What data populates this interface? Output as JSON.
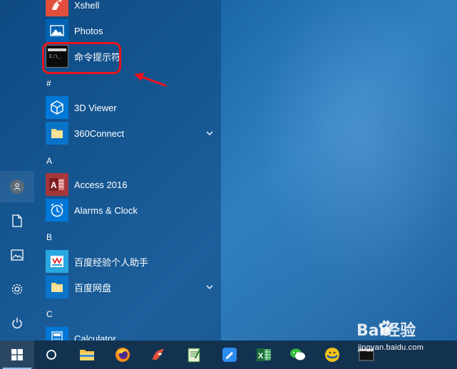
{
  "start_menu": {
    "sections": [
      {
        "letter": ""
      },
      {
        "letter": "#"
      },
      {
        "letter": "A"
      },
      {
        "letter": "B"
      },
      {
        "letter": "C"
      }
    ],
    "apps": {
      "xshell": {
        "label": "Xshell",
        "icon": "xshell-icon"
      },
      "photos": {
        "label": "Photos",
        "icon": "photos-icon"
      },
      "cmd": {
        "label": "命令提示符",
        "icon": "command-prompt-icon"
      },
      "viewer3d": {
        "label": "3D Viewer",
        "icon": "3d-viewer-icon"
      },
      "connect360": {
        "label": "360Connect",
        "icon": "folder-icon"
      },
      "access": {
        "label": "Access 2016",
        "icon": "access-icon"
      },
      "alarms": {
        "label": "Alarms & Clock",
        "icon": "alarm-clock-icon"
      },
      "baidu_helper": {
        "label": "百度经验个人助手",
        "icon": "baidu-helper-icon"
      },
      "baidu_pan": {
        "label": "百度网盘",
        "icon": "folder-icon"
      },
      "calculator": {
        "label": "Calculator",
        "icon": "calculator-icon"
      }
    },
    "section_letters": {
      "hash": "#",
      "a": "A",
      "b": "B",
      "c": "C"
    }
  },
  "watermark": {
    "brand": "Bai经验",
    "url": "jingyan.baidu.com"
  },
  "colors": {
    "highlight": "#e8141c",
    "taskbar": "#12324f"
  }
}
